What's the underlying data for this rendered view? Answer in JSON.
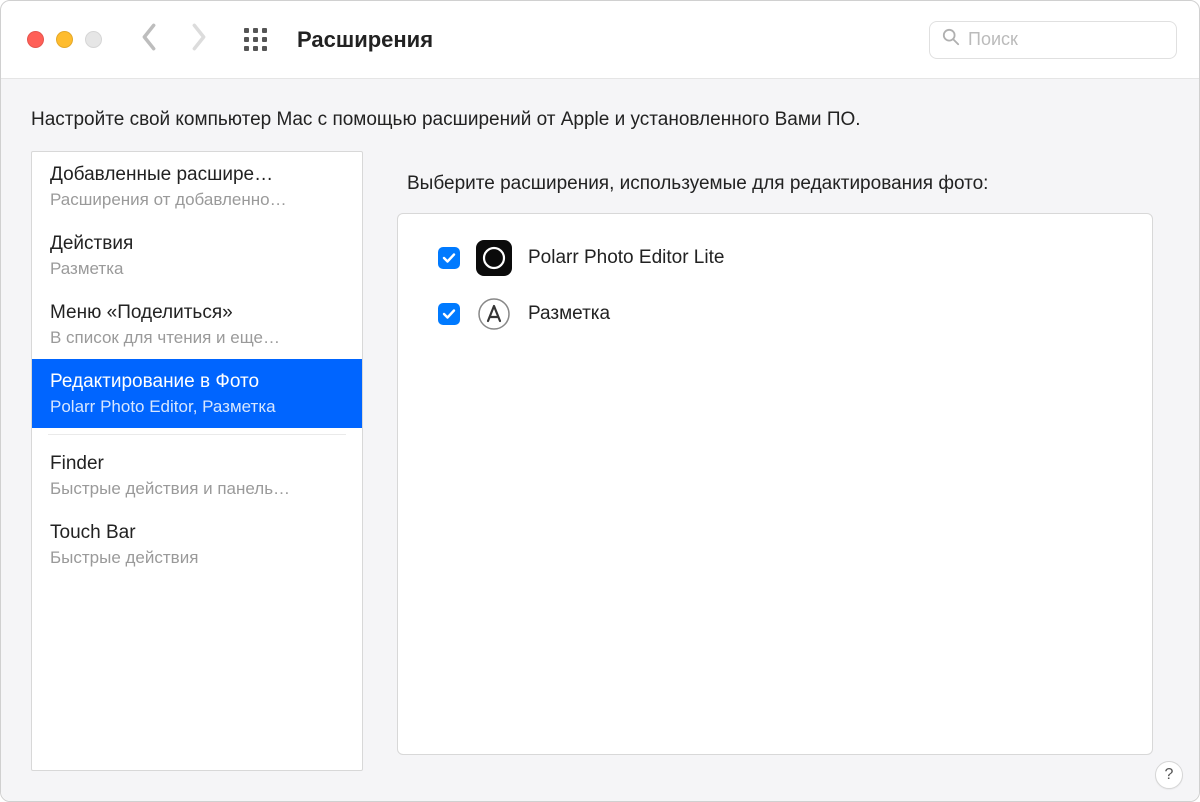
{
  "header": {
    "title": "Расширения",
    "search_placeholder": "Поиск"
  },
  "intro": "Настройте свой компьютер Mac с помощью расширений от Apple и установленного Вами ПО.",
  "sidebar": {
    "items": [
      {
        "title": "Добавленные расшире…",
        "subtitle": "Расширения от добавленно…",
        "selected": false
      },
      {
        "title": "Действия",
        "subtitle": "Разметка",
        "selected": false
      },
      {
        "title": "Меню «Поделиться»",
        "subtitle": "В список для чтения и еще…",
        "selected": false
      },
      {
        "title": "Редактирование в Фото",
        "subtitle": "Polarr Photo Editor, Разметка",
        "selected": true
      },
      {
        "title": "Finder",
        "subtitle": "Быстрые действия и панель…",
        "selected": false
      },
      {
        "title": "Touch Bar",
        "subtitle": "Быстрые действия",
        "selected": false
      }
    ]
  },
  "detail": {
    "heading": "Выберите расширения, используемые для редактирования фото:",
    "rows": [
      {
        "label": "Polarr Photo Editor Lite",
        "checked": true,
        "icon": "polarr"
      },
      {
        "label": "Разметка",
        "checked": true,
        "icon": "markup"
      }
    ]
  },
  "help_label": "?"
}
